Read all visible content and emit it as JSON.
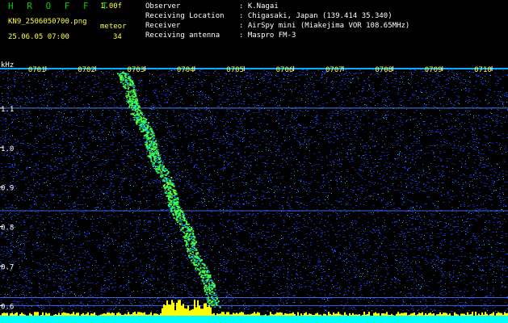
{
  "header": {
    "app_name": "H R O F F T",
    "version": "1.00f",
    "file_name": "KN9_2506050700.png",
    "meteor_label": "meteor",
    "datetime": "25.06.05 07:00",
    "meteor_count": "34",
    "info_labels": [
      "Observer",
      "Receiving Location",
      "Receiver",
      "Receiving antenna"
    ],
    "info_values": [
      ": K.Nagai",
      ": Chigasaki, Japan (139.414 35.340)",
      ": AirSpy mini (Miakejima VOR 108.65MHz)",
      ": Maspro FM-3"
    ]
  },
  "spectrogram": {
    "y_unit": "kHz",
    "y_ticks": [
      "1.1",
      "1.0",
      "0.9",
      "0.8",
      "0.7",
      "0.6"
    ],
    "y_tick_values": [
      1.1,
      1.0,
      0.9,
      0.8,
      0.7,
      0.6
    ],
    "y_range": [
      0.57,
      1.2
    ],
    "time_labels": [
      "0701",
      "0702",
      "0703",
      "0704",
      "0705",
      "0706",
      "0707",
      "0708",
      "0709",
      "0710"
    ],
    "time_minutes": [
      1,
      2,
      3,
      4,
      5,
      6,
      7,
      8,
      9,
      10
    ],
    "x_range_minutes": [
      0.4,
      10.65
    ],
    "horizontal_lines_khz": [
      1.1,
      0.84,
      0.62,
      0.6
    ],
    "meteor_trail": {
      "start": [
        2.85,
        1.19
      ],
      "end": [
        4.75,
        0.6
      ]
    },
    "colors": {
      "background": "#000000",
      "noise": "#1030c0",
      "cyan": "#00ffff",
      "signal": "#40ff40",
      "hot": "#ffff00",
      "axis_line": "#00b0ff"
    }
  }
}
